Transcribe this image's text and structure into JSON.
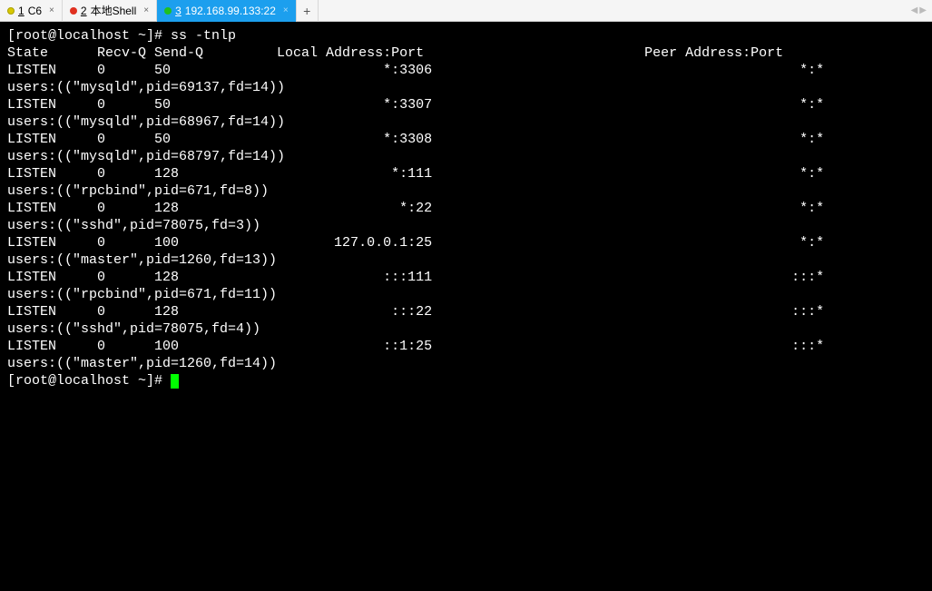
{
  "tabs": [
    {
      "num": "1",
      "label": "C6",
      "dot": "yellow",
      "active": false
    },
    {
      "num": "2",
      "label": "本地Shell",
      "dot": "red",
      "active": false
    },
    {
      "num": "3",
      "label": "192.168.99.133:22",
      "dot": "green",
      "active": true
    }
  ],
  "newtab": "+",
  "navLeft": "◀",
  "navRight": "▶",
  "terminal": {
    "prompt1": "[root@localhost ~]# ",
    "cmd1": "ss -tnlp",
    "header": {
      "state": "State",
      "recvq": "Recv-Q",
      "sendq": "Send-Q",
      "local": "Local Address:Port",
      "peer": "Peer Address:Port"
    },
    "rows": [
      {
        "state": "LISTEN",
        "recvq": "0",
        "sendq": "50",
        "local": "*:3306",
        "peer": "*:*",
        "users": "users:((\"mysqld\",pid=69137,fd=14))"
      },
      {
        "state": "LISTEN",
        "recvq": "0",
        "sendq": "50",
        "local": "*:3307",
        "peer": "*:*",
        "users": "users:((\"mysqld\",pid=68967,fd=14))"
      },
      {
        "state": "LISTEN",
        "recvq": "0",
        "sendq": "50",
        "local": "*:3308",
        "peer": "*:*",
        "users": "users:((\"mysqld\",pid=68797,fd=14))"
      },
      {
        "state": "LISTEN",
        "recvq": "0",
        "sendq": "128",
        "local": "*:111",
        "peer": "*:*",
        "users": "users:((\"rpcbind\",pid=671,fd=8))"
      },
      {
        "state": "LISTEN",
        "recvq": "0",
        "sendq": "128",
        "local": "*:22",
        "peer": "*:*",
        "users": "users:((\"sshd\",pid=78075,fd=3))"
      },
      {
        "state": "LISTEN",
        "recvq": "0",
        "sendq": "100",
        "local": "127.0.0.1:25",
        "peer": "*:*",
        "users": "users:((\"master\",pid=1260,fd=13))"
      },
      {
        "state": "LISTEN",
        "recvq": "0",
        "sendq": "128",
        "local": ":::111",
        "peer": ":::*",
        "users": "users:((\"rpcbind\",pid=671,fd=11))"
      },
      {
        "state": "LISTEN",
        "recvq": "0",
        "sendq": "128",
        "local": ":::22",
        "peer": ":::*",
        "users": "users:((\"sshd\",pid=78075,fd=4))"
      },
      {
        "state": "LISTEN",
        "recvq": "0",
        "sendq": "100",
        "local": "::1:25",
        "peer": ":::*",
        "users": "users:((\"master\",pid=1260,fd=14))"
      }
    ],
    "prompt2": "[root@localhost ~]# "
  }
}
